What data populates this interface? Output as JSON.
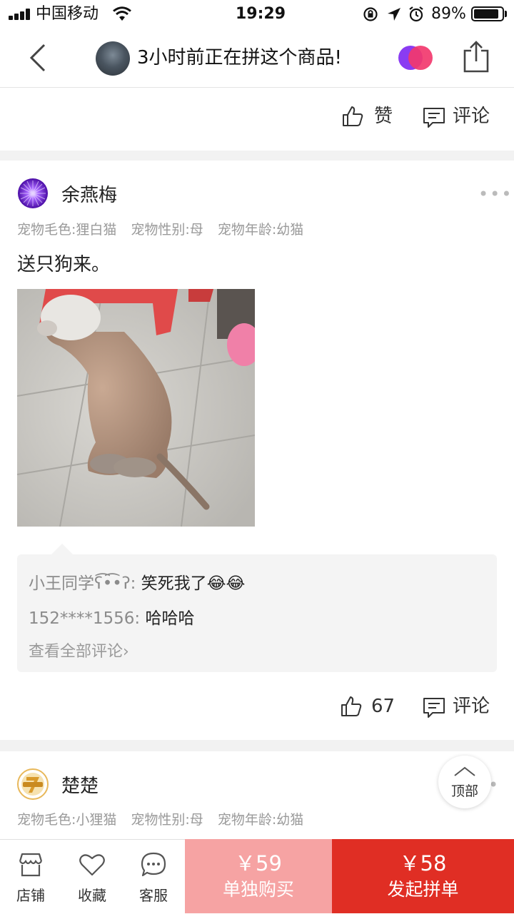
{
  "status_bar": {
    "carrier": "中国移动",
    "time": "19:29",
    "battery": "89%",
    "battery_level": 0.89
  },
  "nav": {
    "title": "3小时前正在拼这个商品!"
  },
  "first_post_actions": {
    "like_label": "赞",
    "comment_label": "评论"
  },
  "post": {
    "user": "余燕梅",
    "meta": [
      "宠物毛色:狸白猫",
      "宠物性别:母",
      "宠物年龄:幼猫"
    ],
    "text": "送只狗来。",
    "comments": [
      {
        "user": "小王同学ʕ͡•͡•ʔ:",
        "text": "笑死我了😂😂"
      },
      {
        "user": "152****1556:",
        "text": "哈哈哈"
      }
    ],
    "view_all": "查看全部评论",
    "likes": "67",
    "comment_label": "评论"
  },
  "next_post": {
    "user": "楚楚",
    "meta": [
      "宠物毛色:小狸猫",
      "宠物性别:母",
      "宠物年龄:幼猫"
    ]
  },
  "to_top_label": "顶部",
  "bottom_bar": {
    "tabs": [
      "店铺",
      "收藏",
      "客服"
    ],
    "single_price": "￥59",
    "single_label": "单独购买",
    "group_price": "￥58",
    "group_label": "发起拼单"
  },
  "colors": {
    "group_buy": "#e02e24",
    "single_buy": "#f6a3a3"
  }
}
